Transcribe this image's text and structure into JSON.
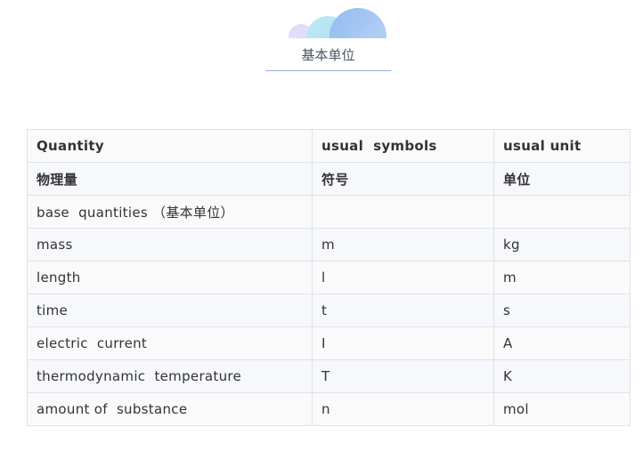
{
  "section_title": "基本单位",
  "header_icon": "decorative-circles-icon",
  "colors": {
    "title_underline": "#8fb3dc",
    "row_odd": "#fafafa",
    "row_even": "#f6f8fc",
    "border": "#dfe3e8"
  },
  "table": {
    "header": [
      "Quantity",
      "usual  symbols",
      "usual unit"
    ],
    "subheader": [
      "物理量",
      "符号",
      "单位"
    ],
    "rows": [
      [
        "base  quantities （基本单位）",
        "",
        ""
      ],
      [
        "mass",
        "m",
        "kg"
      ],
      [
        "length",
        "l",
        "m"
      ],
      [
        "time",
        "t",
        "s"
      ],
      [
        "electric  current",
        "I",
        "A"
      ],
      [
        "thermodynamic  temperature",
        "T",
        "K"
      ],
      [
        "amount of  substance",
        "n",
        "mol"
      ]
    ]
  }
}
